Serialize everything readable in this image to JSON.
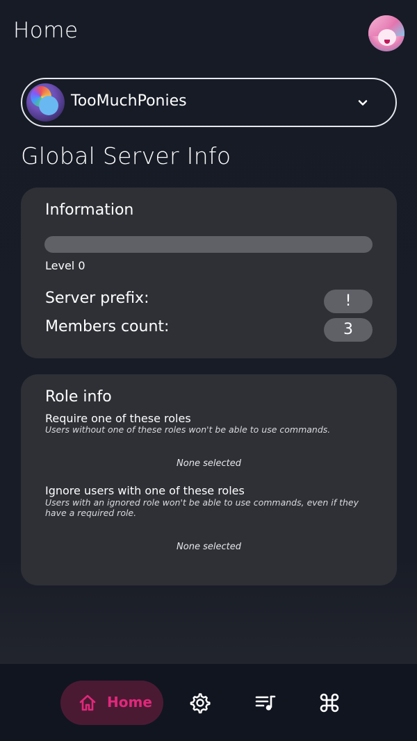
{
  "header": {
    "title": "Home"
  },
  "server": {
    "name": "TooMuchPonies"
  },
  "section": {
    "title": "Global Server Info"
  },
  "info_card": {
    "title": "Information",
    "level_progress": 0,
    "level_label": "Level 0",
    "prefix_label": "Server prefix:",
    "prefix_value": "!",
    "members_label": "Members count:",
    "members_value": "3"
  },
  "role_card": {
    "title": "Role info",
    "require_heading": "Require one of these roles",
    "require_desc": "Users without one of these roles won't be able to use commands.",
    "require_value": "None selected",
    "ignore_heading": "Ignore users with one of these roles",
    "ignore_desc": "Users with an ignored role won't be able to use commands, even if they have a required role.",
    "ignore_value": "None selected"
  },
  "nav": {
    "items": [
      {
        "label": "Home",
        "icon": "home-icon",
        "active": true
      },
      {
        "label": "",
        "icon": "gear-icon"
      },
      {
        "label": "",
        "icon": "playlist-icon"
      },
      {
        "label": "",
        "icon": "command-icon"
      }
    ],
    "accent": "#e0287a"
  }
}
